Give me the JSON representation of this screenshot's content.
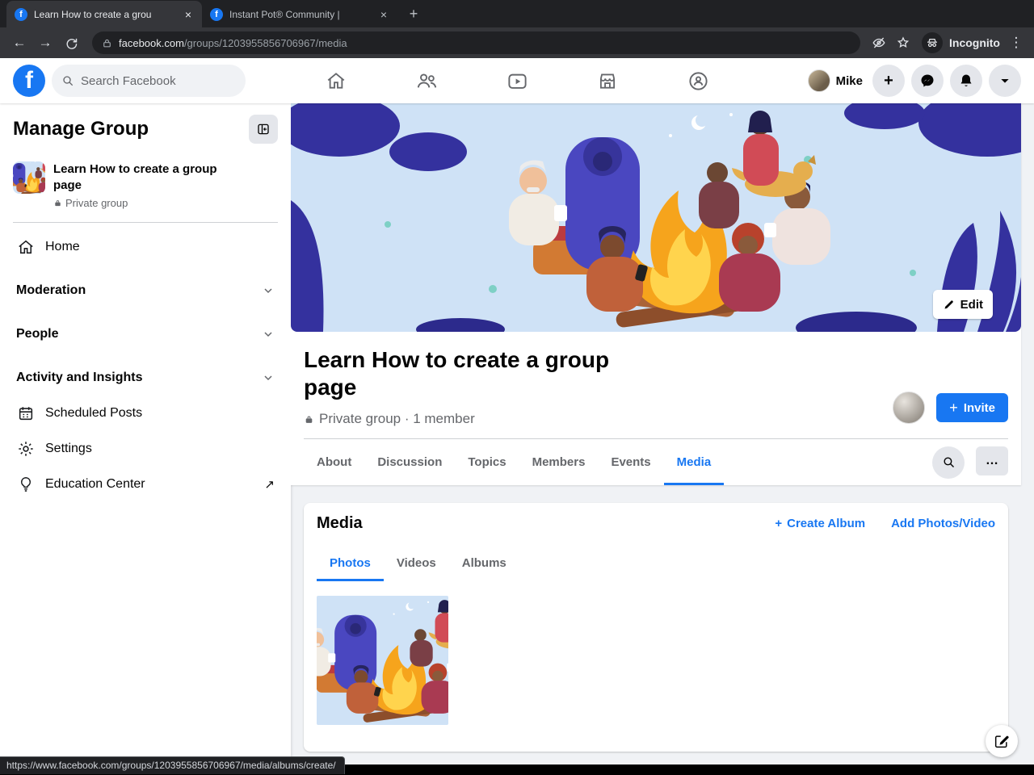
{
  "browser": {
    "tab1": {
      "title": "Learn How to create a grou"
    },
    "tab2": {
      "title": "Instant Pot® Community |"
    },
    "url": {
      "domain": "facebook.com",
      "path": "/groups/1203955856706967/media"
    },
    "incognito_label": "Incognito",
    "status_url": "https://www.facebook.com/groups/1203955856706967/media/albums/create/"
  },
  "fb_header": {
    "search_placeholder": "Search Facebook",
    "user": "Mike"
  },
  "sidebar": {
    "title": "Manage Group",
    "group": {
      "name": "Learn How to create a group page",
      "privacy": "Private group"
    },
    "home_label": "Home",
    "sections": [
      {
        "label": "Moderation"
      },
      {
        "label": "People"
      },
      {
        "label": "Activity and Insights"
      }
    ],
    "links": [
      {
        "label": "Scheduled Posts"
      },
      {
        "label": "Settings"
      },
      {
        "label": "Education Center"
      }
    ],
    "external_arrow": "↗"
  },
  "main": {
    "edit_label": "Edit",
    "title": "Learn How to create a group page",
    "meta": "Private group · 1 member",
    "invite_label": "Invite",
    "tabs": [
      {
        "label": "About"
      },
      {
        "label": "Discussion"
      },
      {
        "label": "Topics"
      },
      {
        "label": "Members"
      },
      {
        "label": "Events"
      },
      {
        "label": "Media",
        "active": true
      }
    ],
    "media": {
      "title": "Media",
      "create_album": "Create Album",
      "add_photos": "Add Photos/Video",
      "subtabs": [
        {
          "label": "Photos",
          "active": true
        },
        {
          "label": "Videos"
        },
        {
          "label": "Albums"
        }
      ]
    }
  },
  "colors": {
    "fb_blue": "#1877f2",
    "page_bg": "#f0f2f5",
    "chrome_dark": "#202124",
    "chrome_toolbar": "#35363a"
  }
}
